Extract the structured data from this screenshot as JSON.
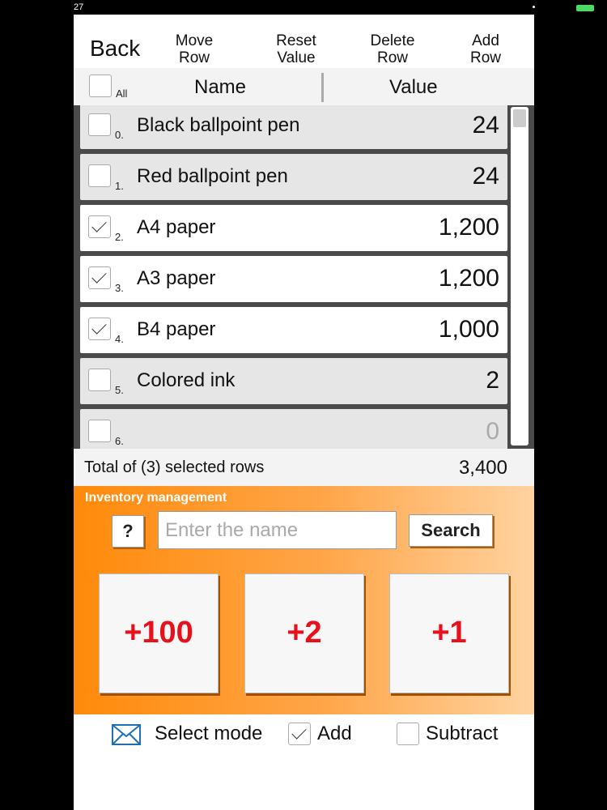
{
  "status": {
    "time": "27"
  },
  "toolbar": {
    "back": "Back",
    "move_row": "Move\nRow",
    "reset_value": "Reset\nValue",
    "delete_row": "Delete\nRow",
    "add_row": "Add\nRow"
  },
  "header": {
    "all_label": "All",
    "name_col": "Name",
    "value_col": "Value",
    "all_checked": false
  },
  "rows": [
    {
      "index": "0.",
      "name": "Black ballpoint pen",
      "value": "24",
      "checked": false
    },
    {
      "index": "1.",
      "name": "Red ballpoint pen",
      "value": "24",
      "checked": false
    },
    {
      "index": "2.",
      "name": "A4 paper",
      "value": "1,200",
      "checked": true
    },
    {
      "index": "3.",
      "name": "A3 paper",
      "value": "1,200",
      "checked": true
    },
    {
      "index": "4.",
      "name": "B4 paper",
      "value": "1,000",
      "checked": true
    },
    {
      "index": "5.",
      "name": "Colored ink",
      "value": "2",
      "checked": false
    },
    {
      "index": "6.",
      "name": "",
      "value": "0",
      "checked": false
    }
  ],
  "total": {
    "label": "Total of (3) selected rows",
    "value": "3,400"
  },
  "panel": {
    "title": "Inventory management",
    "help": "?",
    "search_placeholder": "Enter the name",
    "search_button": "Search",
    "increments": [
      "+100",
      "+2",
      "+1"
    ]
  },
  "footer": {
    "select_mode": "Select mode",
    "add_label": "Add",
    "add_checked": true,
    "subtract_label": "Subtract",
    "subtract_checked": false
  },
  "colors": {
    "accent_orange": "#ff8a0a",
    "increment_red": "#e8101a",
    "mail_icon_blue": "#1e6fb8"
  },
  "icons": {
    "mail": "envelope-icon",
    "scrollbar": "scrollbar",
    "checkbox": "checkbox"
  }
}
